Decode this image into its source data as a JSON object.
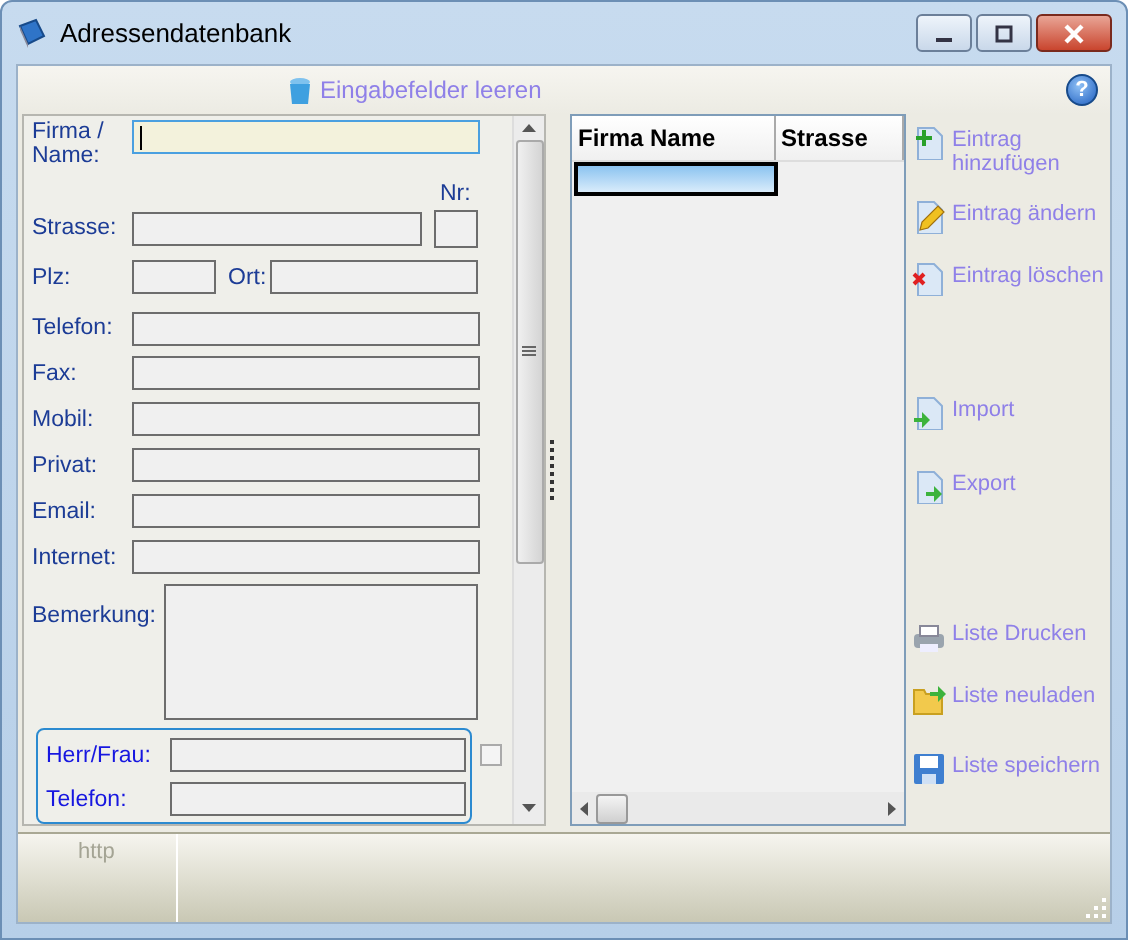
{
  "window": {
    "title": "Adressendatenbank"
  },
  "toolbar": {
    "clear_button": "Eingabefelder leeren",
    "help_button": "?"
  },
  "form": {
    "fields": [
      {
        "label": "Firma / Name:",
        "kind": "wide",
        "focused": true
      },
      {
        "label": "Strasse:",
        "kind": "pair_right",
        "second_label": "Nr:",
        "focused": false
      },
      {
        "label": "Plz:",
        "kind": "pair_left",
        "second_label": "Ort:",
        "focused": false
      },
      {
        "label": "Telefon:",
        "kind": "wide",
        "focused": false
      },
      {
        "label": "Fax:",
        "kind": "wide",
        "focused": false
      },
      {
        "label": "Mobil:",
        "kind": "wide",
        "focused": false
      },
      {
        "label": "Privat:",
        "kind": "wide",
        "focused": false
      },
      {
        "label": "Email:",
        "kind": "wide",
        "focused": false
      },
      {
        "label": "Internet:",
        "kind": "wide",
        "focused": false
      },
      {
        "label": "Bemerkung:",
        "kind": "memo",
        "focused": false
      }
    ],
    "contact_group": {
      "checked": false,
      "fields": [
        {
          "label": "Herr/Frau:"
        },
        {
          "label": "Telefon:"
        }
      ]
    }
  },
  "table": {
    "columns": [
      "Firma Name",
      "Strasse"
    ],
    "rows": [
      {
        "selected": true
      }
    ]
  },
  "actions": [
    {
      "label": "Eintrag hinzufügen",
      "kind": "add"
    },
    {
      "label": "Eintrag ändern",
      "kind": "edit"
    },
    {
      "label": "Eintrag löschen",
      "kind": "delete"
    },
    {
      "label": "Import",
      "kind": "import"
    },
    {
      "label": "Export",
      "kind": "export"
    },
    {
      "label": "Liste Drucken",
      "kind": "print"
    },
    {
      "label": "Liste neuladen",
      "kind": "reload"
    },
    {
      "label": "Liste speichern",
      "kind": "save"
    }
  ],
  "status_bar": {
    "sections": [
      "http"
    ]
  }
}
